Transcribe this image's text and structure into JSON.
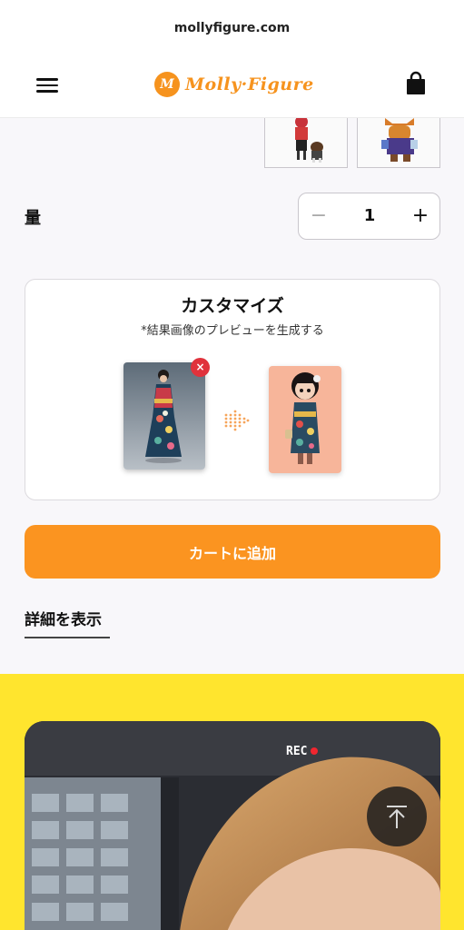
{
  "browser": {
    "url": "mollyfigure.com"
  },
  "header": {
    "logo_mark": "M",
    "logo_text": "Molly·Figure"
  },
  "quantity": {
    "label": "量",
    "minus": "−",
    "value": "1",
    "plus": "+"
  },
  "customize": {
    "title": "カスタマイズ",
    "subtitle": "*結果画像のプレビューを生成する",
    "remove": "×"
  },
  "actions": {
    "add_to_cart": "カートに追加",
    "details": "詳細を表示"
  },
  "video": {
    "rec_label": "REC"
  },
  "colors": {
    "accent": "#fb9420",
    "yellow_bg": "#ffe52e",
    "remove_red": "#e0323c"
  }
}
